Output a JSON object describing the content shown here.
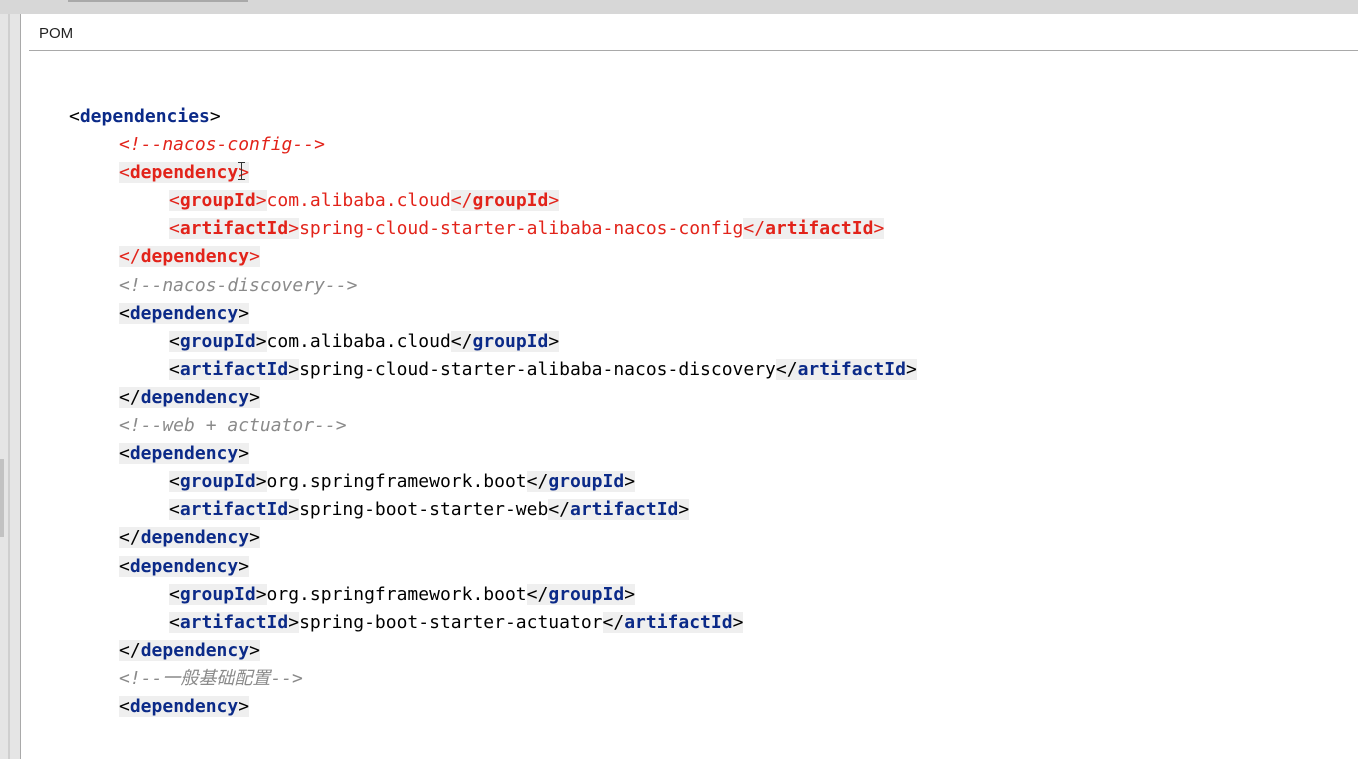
{
  "panel": {
    "title": "POM"
  },
  "code": {
    "dependencies_tag": "dependencies",
    "comment_nacos_config": "<!--nacos-config-->",
    "comment_nacos_discovery": "<!--nacos-discovery-->",
    "comment_web_actuator": "<!--web + actuator-->",
    "comment_general": "<!--一般基础配置-->",
    "dependency_tag": "dependency",
    "groupId_tag": "groupId",
    "artifactId_tag": "artifactId",
    "deps": [
      {
        "groupId": "com.alibaba.cloud",
        "artifactId": "spring-cloud-starter-alibaba-nacos-config"
      },
      {
        "groupId": "com.alibaba.cloud",
        "artifactId": "spring-cloud-starter-alibaba-nacos-discovery"
      },
      {
        "groupId": "org.springframework.boot",
        "artifactId": "spring-boot-starter-web"
      },
      {
        "groupId": "org.springframework.boot",
        "artifactId": "spring-boot-starter-actuator"
      }
    ]
  },
  "colors": {
    "tag": "#0b2a88",
    "highlight_red": "#e2231a",
    "comment_gray": "#8a8a8a",
    "line_highlight": "#efefef"
  },
  "icons": {
    "cursor": "text-cursor-icon"
  }
}
